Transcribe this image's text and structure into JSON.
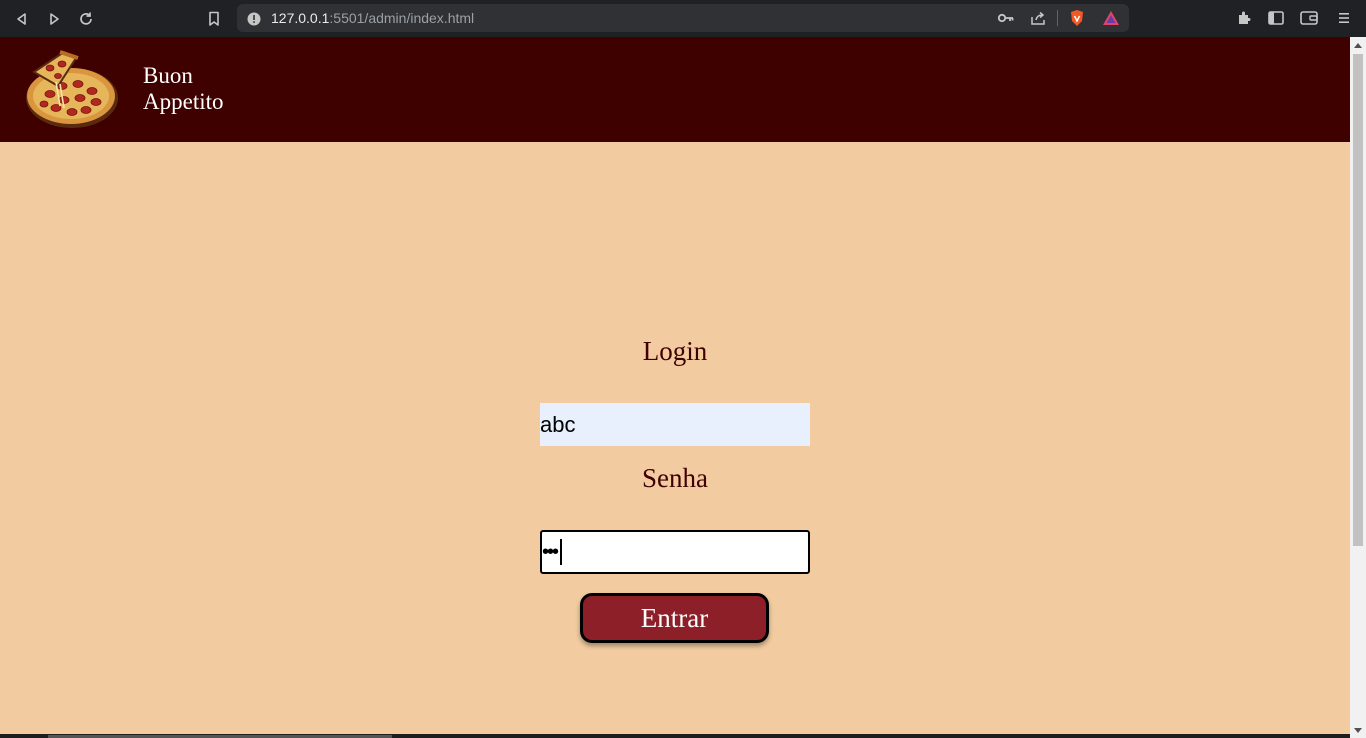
{
  "browser": {
    "url_host": "127.0.0.1",
    "url_rest": ":5501/admin/index.html"
  },
  "icons": {
    "back": "back-icon",
    "forward": "forward-icon",
    "reload": "reload-icon",
    "bookmark": "bookmark-icon",
    "info": "info-icon",
    "key": "key-icon",
    "share": "share-icon",
    "brave": "brave-shield-icon",
    "rewards": "brave-rewards-icon",
    "extensions": "extensions-icon",
    "sidebar": "sidebar-icon",
    "wallet": "wallet-icon",
    "menu": "menu-icon"
  },
  "header": {
    "brand_line1": "Buon",
    "brand_line2": "Appetito",
    "background": "#3f0000"
  },
  "form": {
    "login_label": "Login",
    "login_value": "abc",
    "senha_label": "Senha",
    "senha_masked": "•••",
    "submit_label": "Entrar"
  },
  "colors": {
    "page_background": "#f2cca0",
    "button_background": "#8c1f28",
    "label_color": "#3f0000",
    "autofill_background": "#e8f0fe"
  }
}
